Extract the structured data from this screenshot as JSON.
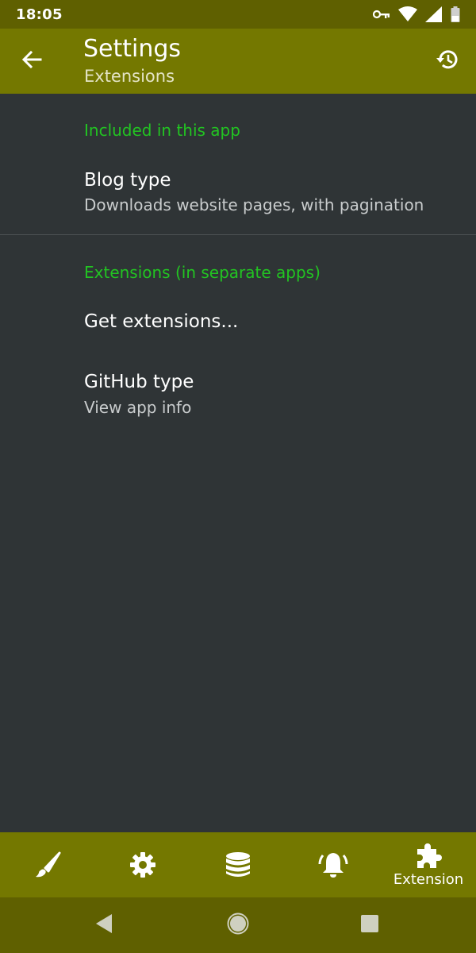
{
  "status_bar": {
    "time": "18:05",
    "icons": [
      "vpn-key-icon",
      "wifi-icon",
      "signal-icon",
      "battery-icon"
    ]
  },
  "app_bar": {
    "title": "Settings",
    "subtitle": "Extensions",
    "back_icon": "arrow-back-icon",
    "history_icon": "history-icon",
    "background": "#747800"
  },
  "sections": {
    "included": {
      "header": "Included in this app",
      "items": [
        {
          "title": "Blog type",
          "summary": "Downloads website pages, with pagination"
        }
      ]
    },
    "extensions": {
      "header": "Extensions (in separate apps)",
      "items": [
        {
          "title": "Get extensions..."
        },
        {
          "title": "GitHub type",
          "summary": "View app info"
        }
      ]
    }
  },
  "bottom_nav": {
    "items": [
      {
        "icon": "brush-icon"
      },
      {
        "icon": "gear-icon"
      },
      {
        "icon": "database-icon"
      },
      {
        "icon": "bell-icon"
      },
      {
        "icon": "puzzle-icon",
        "label": "Extension",
        "selected": true
      }
    ]
  },
  "system_nav": {
    "buttons": [
      "back-triangle-icon",
      "home-circle-icon",
      "recents-square-icon"
    ]
  },
  "colors": {
    "accent": "#22c422",
    "toolbar": "#747800",
    "status_bar": "#5f6000",
    "background": "#2f3436"
  }
}
